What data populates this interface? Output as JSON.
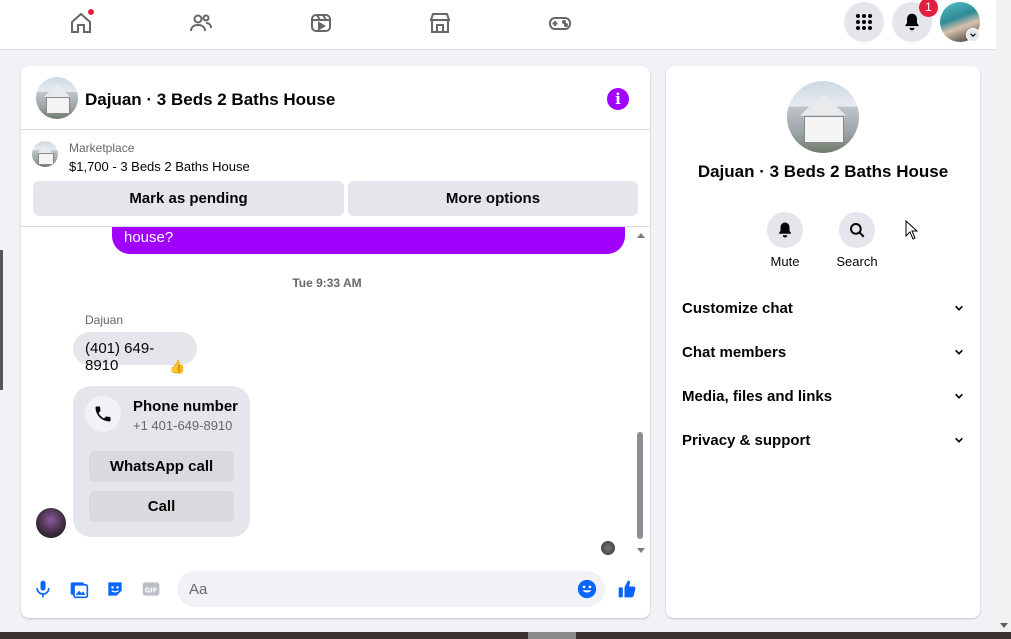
{
  "nav": {
    "icons": [
      "home-icon",
      "friends-icon",
      "video-icon",
      "marketplace-icon",
      "gaming-icon"
    ],
    "notification_count": "1"
  },
  "chat": {
    "title": "Dajuan · 3 Beds 2 Baths House",
    "marketplace_label": "Marketplace",
    "listing": "$1,700 - 3 Beds 2 Baths House",
    "mark_pending": "Mark as pending",
    "more_options": "More options",
    "outgoing_partial": "house?",
    "timestamp": "Tue 9:33 AM",
    "sender": "Dajuan",
    "incoming_message": "(401) 649-8910",
    "reaction": "👍",
    "phone_card": {
      "title": "Phone number",
      "number": "+1 401-649-8910",
      "whatsapp": "WhatsApp call",
      "call": "Call"
    },
    "composer_placeholder": "Aa",
    "accent": "#a100ff",
    "blue": "#0866ff"
  },
  "info": {
    "title": "Dajuan · 3 Beds 2 Baths House",
    "mute": "Mute",
    "search": "Search",
    "sections": [
      "Customize chat",
      "Chat members",
      "Media, files and links",
      "Privacy & support"
    ]
  }
}
